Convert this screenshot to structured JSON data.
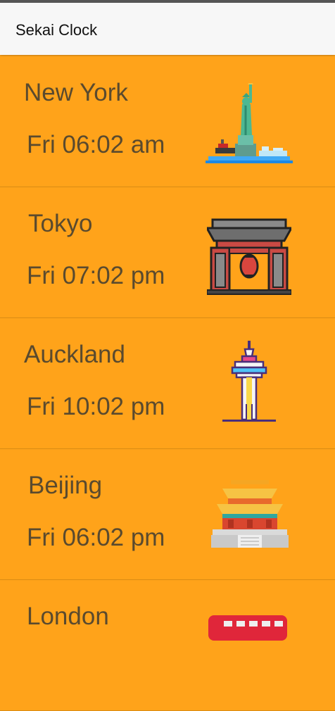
{
  "app": {
    "title": "Sekai Clock"
  },
  "cities": [
    {
      "name": "New York",
      "time": "Fri 06:02 am",
      "icon": "statue-of-liberty-icon"
    },
    {
      "name": "Tokyo",
      "time": "Fri 07:02 pm",
      "icon": "sensoji-gate-icon"
    },
    {
      "name": "Auckland",
      "time": "Fri 10:02 pm",
      "icon": "sky-tower-icon"
    },
    {
      "name": "Beijing",
      "time": "Fri 06:02 pm",
      "icon": "forbidden-city-icon"
    },
    {
      "name": "London",
      "time": "",
      "icon": "london-bus-icon"
    }
  ],
  "colors": {
    "accent": "#FFA31A",
    "text": "#5A4A2E",
    "appbar": "#F7F7F7"
  }
}
